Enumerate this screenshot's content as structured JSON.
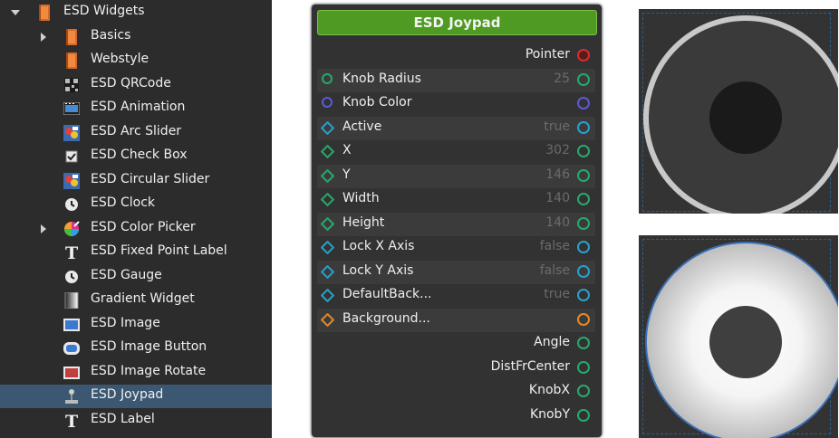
{
  "tree": {
    "items": [
      {
        "label": "ESD Widgets",
        "icon": "book-icon",
        "arrow": "down"
      },
      {
        "label": "Basics",
        "icon": "book-icon",
        "arrow": "right"
      },
      {
        "label": "Webstyle",
        "icon": "book-icon",
        "arrow": ""
      },
      {
        "label": "ESD QRCode",
        "icon": "qrcode-icon",
        "arrow": ""
      },
      {
        "label": "ESD Animation",
        "icon": "animation-icon",
        "arrow": ""
      },
      {
        "label": "ESD Arc Slider",
        "icon": "arc-slider-icon",
        "arrow": ""
      },
      {
        "label": "ESD Check Box",
        "icon": "checkbox-icon",
        "arrow": ""
      },
      {
        "label": "ESD Circular Slider",
        "icon": "circular-slider-icon",
        "arrow": ""
      },
      {
        "label": "ESD Clock",
        "icon": "clock-icon",
        "arrow": ""
      },
      {
        "label": "ESD Color Picker",
        "icon": "color-picker-icon",
        "arrow": "right"
      },
      {
        "label": "ESD Fixed Point Label",
        "icon": "text-icon",
        "arrow": ""
      },
      {
        "label": "ESD Gauge",
        "icon": "gauge-icon",
        "arrow": ""
      },
      {
        "label": "Gradient Widget",
        "icon": "gradient-icon",
        "arrow": ""
      },
      {
        "label": "ESD Image",
        "icon": "image-icon",
        "arrow": ""
      },
      {
        "label": "ESD Image Button",
        "icon": "image-button-icon",
        "arrow": ""
      },
      {
        "label": "ESD Image Rotate",
        "icon": "image-rotate-icon",
        "arrow": ""
      },
      {
        "label": "ESD Joypad",
        "icon": "joystick-icon",
        "arrow": "",
        "selected": true
      },
      {
        "label": "ESD Label",
        "icon": "text-icon",
        "arrow": ""
      }
    ]
  },
  "node": {
    "title": "ESD Joypad",
    "pointer_label": "Pointer",
    "properties": [
      {
        "label": "Knob Radius",
        "value": "25",
        "in": "circle",
        "color": "#2aa86a"
      },
      {
        "label": "Knob Color",
        "value": "",
        "in": "circle",
        "color": "#5a5ad8"
      },
      {
        "label": "Active",
        "value": "true",
        "in": "diamond",
        "color": "#2aa0c8"
      },
      {
        "label": "X",
        "value": "302",
        "in": "diamond",
        "color": "#2aa86a"
      },
      {
        "label": "Y",
        "value": "146",
        "in": "diamond",
        "color": "#2aa86a"
      },
      {
        "label": "Width",
        "value": "140",
        "in": "diamond",
        "color": "#2aa86a"
      },
      {
        "label": "Height",
        "value": "140",
        "in": "diamond",
        "color": "#2aa86a"
      },
      {
        "label": "Lock X Axis",
        "value": "false",
        "in": "diamond",
        "color": "#2aa0c8"
      },
      {
        "label": "Lock Y Axis",
        "value": "false",
        "in": "diamond",
        "color": "#2aa0c8"
      },
      {
        "label": "DefaultBack...",
        "value": "true",
        "in": "diamond",
        "color": "#2aa0c8"
      },
      {
        "label": "Background...",
        "value": "",
        "in": "diamond",
        "color": "#e08a2a"
      }
    ],
    "outputs": [
      "Angle",
      "DistFrCenter",
      "KnobX",
      "KnobY"
    ]
  },
  "colors": {
    "pointer_port": "#d03030",
    "output_port": "#2aa86a",
    "title_bar": "#4f9a23",
    "selection": "#3b5772"
  }
}
